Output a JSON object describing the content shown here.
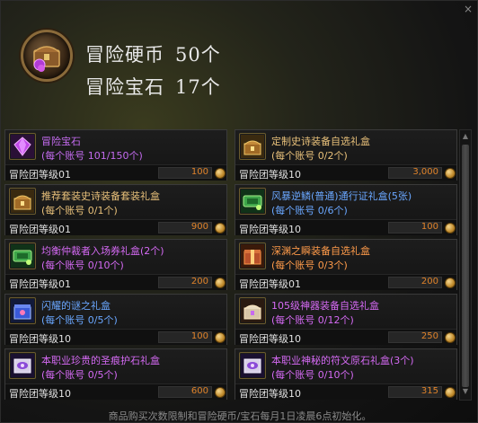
{
  "header": {
    "coin_label": "冒险硬币",
    "coin_count": "50个",
    "gem_label": "冒险宝石",
    "gem_count": "17个"
  },
  "items": [
    {
      "name": "冒险宝石",
      "limit": "(每个账号 101/150个)",
      "level": "冒险团等级01",
      "price": "100",
      "name_color": "#c46bf0",
      "icon": "purple-gem-icon"
    },
    {
      "name": "定制史诗装备自选礼盒",
      "limit": "(每个账号 0/2个)",
      "level": "冒险团等级10",
      "price": "3,000",
      "name_color": "#e8c07a",
      "icon": "gold-chest-icon"
    },
    {
      "name": "推荐套装史诗装备套装礼盒",
      "limit": "(每个账号 0/1个)",
      "level": "冒险团等级01",
      "price": "900",
      "name_color": "#e8c07a",
      "icon": "gold-chest-icon"
    },
    {
      "name": "风暴逆鳞(普通)通行证礼盒(5张)",
      "limit": "(每个账号 0/6个)",
      "level": "冒险团等级10",
      "price": "100",
      "name_color": "#6aa7ff",
      "icon": "green-ticket-icon"
    },
    {
      "name": "均衡仲裁者入场券礼盒(2个)",
      "limit": "(每个账号 0/10个)",
      "level": "冒险团等级01",
      "price": "200",
      "name_color": "#d56af4",
      "icon": "green-ticket-icon"
    },
    {
      "name": "深渊之瞬装备自选礼盒",
      "limit": "(每个账号 0/3个)",
      "level": "冒险团等级01",
      "price": "200",
      "name_color": "#ff9b4a",
      "icon": "orange-box-icon"
    },
    {
      "name": "闪耀的谜之礼盒",
      "limit": "(每个账号 0/5个)",
      "level": "冒险团等级10",
      "price": "100",
      "name_color": "#6aa7ff",
      "icon": "blue-box-icon"
    },
    {
      "name": "105级神器装备自选礼盒",
      "limit": "(每个账号 0/12个)",
      "level": "冒险团等级10",
      "price": "250",
      "name_color": "#d56af4",
      "icon": "pink-chest-icon"
    },
    {
      "name": "本职业珍贵的圣痕护石礼盒",
      "limit": "(每个账号 0/5个)",
      "level": "冒险团等级10",
      "price": "600",
      "name_color": "#d56af4",
      "icon": "purple-stone-icon"
    },
    {
      "name": "本职业神秘的符文原石礼盒(3个)",
      "limit": "(每个账号 0/10个)",
      "level": "冒险团等级10",
      "price": "315",
      "name_color": "#d56af4",
      "icon": "purple-stone-icon"
    }
  ],
  "footer": "商品购买次数限制和冒险硬币/宝石每月1日凌晨6点初始化。",
  "close_label": "×"
}
